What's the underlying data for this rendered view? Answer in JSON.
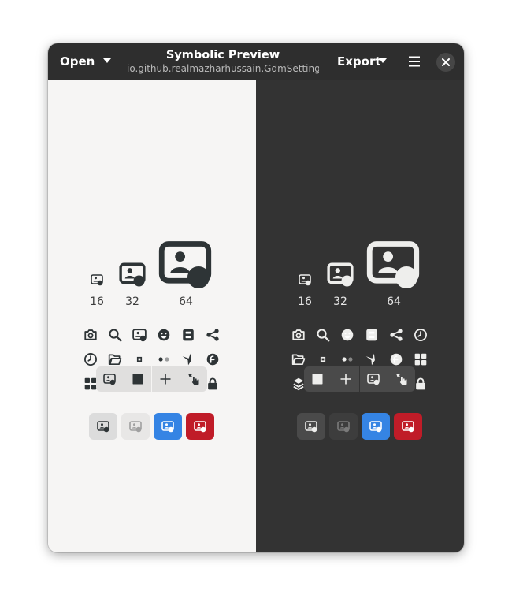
{
  "header": {
    "open_label": "Open",
    "title": "Symbolic Preview",
    "subtitle": "io.github.realmazharhussain.GdmSetting…",
    "export_label": "Export"
  },
  "light_pane": {
    "sizes": [
      "16",
      "32",
      "64"
    ]
  },
  "dark_pane": {
    "sizes": [
      "16",
      "32",
      "64"
    ]
  },
  "colors": {
    "headerbar": "#2e2e2e",
    "light_bg": "#f6f5f4",
    "dark_bg": "#333333",
    "accent_blue": "#3584e4",
    "destructive_red": "#c01c28"
  },
  "icons": [
    "app-settings-icon",
    "camera-icon",
    "search-icon",
    "emoji-icon",
    "dialog-icon",
    "share-icon",
    "clock-icon",
    "folder-open-icon",
    "small-square-icon",
    "dots-icon",
    "arrow-tool-icon",
    "fedora-icon",
    "grid-icon",
    "layers-icon",
    "color-picker-icon",
    "computer-icon",
    "network-icon",
    "lock-icon",
    "square-icon",
    "plus-icon",
    "pointer-icon"
  ]
}
